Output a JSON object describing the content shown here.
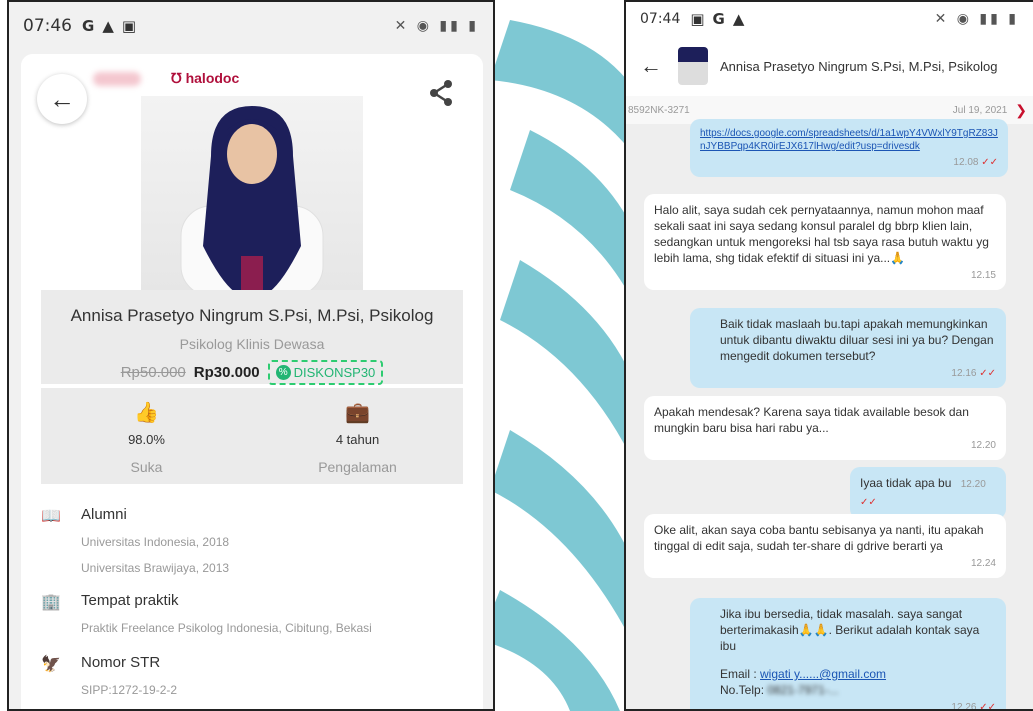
{
  "colors": {
    "brand": "#b0103c",
    "discount": "#22b573",
    "bubble_out": "#c8e6f5",
    "read_tick": "#d33333"
  },
  "left": {
    "status": {
      "time": "07:46"
    },
    "logo": "halodoc",
    "doctor": {
      "name": "Annisa Prasetyo Ningrum S.Psi, M.Psi, Psikolog",
      "specialty": "Psikolog Klinis Dewasa",
      "price_old": "Rp50.000",
      "price_new": "Rp30.000",
      "coupon": "DISKONSP30"
    },
    "stats": [
      {
        "icon": "thumbs-up-icon",
        "value": "98.0%",
        "label": "Suka"
      },
      {
        "icon": "briefcase-icon",
        "value": "4 tahun",
        "label": "Pengalaman"
      }
    ],
    "sections": [
      {
        "icon": "book-icon",
        "title": "Alumni",
        "lines": [
          "Universitas Indonesia, 2018",
          "Universitas Brawijaya, 2013"
        ]
      },
      {
        "icon": "building-icon",
        "title": "Tempat praktik",
        "lines": [
          "Praktik Freelance Psikolog Indonesia, Cibitung, Bekasi"
        ]
      },
      {
        "icon": "garuda-icon",
        "title": "Nomor STR",
        "lines": [
          "SIPP:1272-19-2-2"
        ]
      }
    ]
  },
  "right": {
    "status": {
      "time": "07:44"
    },
    "chat_title": "Annisa Prasetyo Ningrum S.Psi, M.Psi, Psikolog",
    "order_id": "8592NK-3271",
    "date": "Jul 19, 2021",
    "messages": [
      {
        "dir": "out",
        "link": "https://docs.google.com/spreadsheets/d/1a1wpY4VWxlY9TgRZ83JnJYBBPqp4KR0irEJX617lHwg/edit?usp=drivesdk",
        "time": "12.08"
      },
      {
        "dir": "in",
        "text": "Halo alit, saya sudah cek pernyataannya, namun mohon maaf sekali saat ini saya sedang konsul paralel dg bbrp klien lain, sedangkan untuk mengoreksi hal tsb saya rasa butuh waktu yg lebih lama, shg tidak efektif di situasi ini ya...🙏",
        "time": "12.15"
      },
      {
        "dir": "out",
        "text": "Baik tidak maslaah bu.tapi apakah memungkinkan untuk dibantu diwaktu diluar sesi ini ya bu? Dengan mengedit dokumen tersebut?",
        "time": "12.16"
      },
      {
        "dir": "in",
        "text": "Apakah mendesak? Karena saya tidak available besok dan mungkin baru bisa hari rabu ya...",
        "time": "12.20"
      },
      {
        "dir": "out",
        "text": "Iyaa tidak apa bu",
        "time": "12.20"
      },
      {
        "dir": "in",
        "text": "Oke alit, akan saya coba bantu sebisanya ya nanti, itu apakah tinggal di edit saja, sudah ter-share di gdrive berarti ya",
        "time": "12.24"
      },
      {
        "dir": "out",
        "text": "Jika ibu bersedia, tidak masalah. saya sangat berterimakasih🙏🙏. Berikut adalah kontak saya ibu",
        "email_label": "Email : ",
        "email": "wigati y......@gmail.com",
        "phone_label": "No.Telp: ",
        "phone": "0821-7971-...",
        "time": "12.26"
      }
    ]
  }
}
